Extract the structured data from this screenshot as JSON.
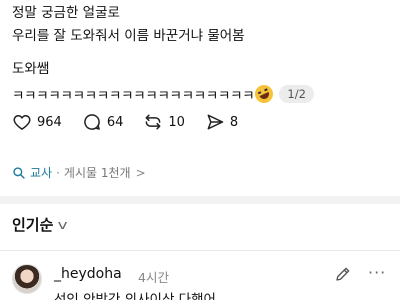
{
  "post": {
    "line1": "정말 궁금한 얼굴로",
    "line2": "우리를 잘 도와줘서 이름 바꾼거냐 물어봄",
    "line3": "도와쌤",
    "laugh": "ㅋㅋㅋㅋㅋㅋㅋㅋㅋㅋㅋㅋㅋㅋㅋㅋㅋㅋㅋㅋ",
    "emoji_icon": "rolling-on-floor-laughing-emoji",
    "page_indicator": "1/2"
  },
  "actions": {
    "likes": "964",
    "comments": "64",
    "reposts": "10",
    "shares": "8"
  },
  "board": {
    "teacher_label": "교사",
    "separator": "·",
    "info": "게시물 1천개",
    "chevron": ">"
  },
  "sort": {
    "label": "인기순"
  },
  "comment": {
    "username": "_heydoha",
    "time": "4시간",
    "more": "···",
    "text": "선인 안방간 의사이상 다했어"
  },
  "colors": {
    "accent_blue": "#1d7a9c",
    "muted": "#888888",
    "divider": "#f2f2f2"
  }
}
